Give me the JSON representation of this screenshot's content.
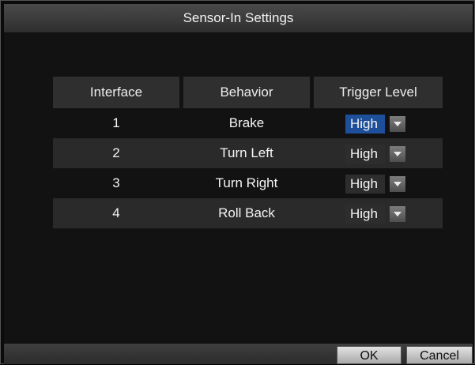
{
  "window": {
    "title": "Sensor-In Settings"
  },
  "table": {
    "headers": [
      "Interface",
      "Behavior",
      "Trigger Level"
    ],
    "rows": [
      {
        "interface": "1",
        "behavior": "Brake",
        "trigger_level": "High",
        "selected": true
      },
      {
        "interface": "2",
        "behavior": "Turn Left",
        "trigger_level": "High",
        "selected": false
      },
      {
        "interface": "3",
        "behavior": "Turn Right",
        "trigger_level": "High",
        "selected": false
      },
      {
        "interface": "4",
        "behavior": "Roll Back",
        "trigger_level": "High",
        "selected": false
      }
    ]
  },
  "footer": {
    "ok_label": "OK",
    "cancel_label": "Cancel"
  },
  "colors": {
    "selection": "#1d4f9a",
    "header_bg": "#2f2f2f",
    "row_alt_bg": "#2a2a2a"
  },
  "icons": {
    "dropdown": "chevron-down-icon"
  }
}
